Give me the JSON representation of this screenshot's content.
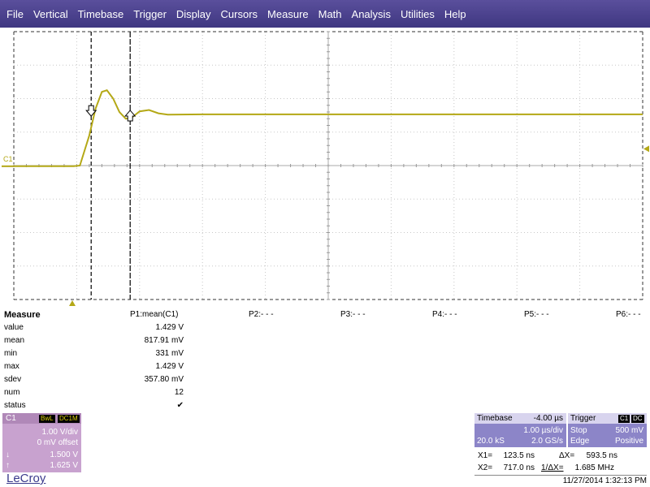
{
  "menu": [
    "File",
    "Vertical",
    "Timebase",
    "Trigger",
    "Display",
    "Cursors",
    "Measure",
    "Math",
    "Analysis",
    "Utilities",
    "Help"
  ],
  "colors": {
    "menubar": "#4a4190",
    "trace": "#b4a816",
    "channel_box": "#c8a2cf",
    "info_box": "#8c85c8"
  },
  "screen": {
    "channel_marker": "C1",
    "h_divisions": 10,
    "v_divisions": 8
  },
  "chart_data": {
    "type": "line",
    "series": [
      {
        "values": [
          [
            0.0,
            -0.02
          ],
          [
            0.95,
            -0.02
          ],
          [
            1.05,
            0.0
          ],
          [
            1.2,
            0.9
          ],
          [
            1.3,
            1.7
          ],
          [
            1.4,
            2.2
          ],
          [
            1.48,
            2.25
          ],
          [
            1.58,
            2.0
          ],
          [
            1.68,
            1.6
          ],
          [
            1.78,
            1.4
          ],
          [
            1.88,
            1.44
          ],
          [
            2.0,
            1.62
          ],
          [
            2.15,
            1.66
          ],
          [
            2.3,
            1.56
          ],
          [
            2.45,
            1.52
          ],
          [
            3.0,
            1.53
          ],
          [
            10.0,
            1.53
          ]
        ]
      }
    ],
    "xlim": [
      0,
      10
    ],
    "ylim": [
      -4,
      4
    ],
    "grid": true,
    "cursors": [
      1.23,
      1.85
    ]
  },
  "measure": {
    "title": "Measure",
    "params": [
      "P1:mean(C1)",
      "P2:- - -",
      "P3:- - -",
      "P4:- - -",
      "P5:- - -",
      "P6:- - -"
    ],
    "rows": [
      {
        "label": "value",
        "val": "1.429 V"
      },
      {
        "label": "mean",
        "val": "817.91 mV"
      },
      {
        "label": "min",
        "val": "331 mV"
      },
      {
        "label": "max",
        "val": "1.429 V"
      },
      {
        "label": "sdev",
        "val": "357.80 mV"
      },
      {
        "label": "num",
        "val": "12"
      },
      {
        "label": "status",
        "val": "✔"
      }
    ]
  },
  "channel": {
    "name": "C1",
    "bwl": "BwL",
    "coupling": "DC1M",
    "scale": "1.00 V/div",
    "offset": "0 mV offset",
    "cursor1_sym": "↓",
    "cursor1": "1.500 V",
    "cursor2_sym": "↑",
    "cursor2": "1.625 V"
  },
  "logo": "LeCroy",
  "timebase": {
    "label": "Timebase",
    "delay": "-4.00 µs",
    "scale": "1.00 µs/div",
    "samples": "20.0 kS",
    "rate": "2.0 GS/s"
  },
  "trigger": {
    "label": "Trigger",
    "source": "C1",
    "coupling": "DC",
    "mode": "Stop",
    "level": "500 mV",
    "type": "Edge",
    "slope": "Positive"
  },
  "cursors": {
    "x1_label": "X1=",
    "x1": "123.5 ns",
    "dx_label": "ΔX=",
    "dx": "593.5 ns",
    "x2_label": "X2=",
    "x2": "717.0 ns",
    "inv_label": "1/ΔX=",
    "inv": "1.685 MHz"
  },
  "datetime": "11/27/2014 1:32:13 PM"
}
